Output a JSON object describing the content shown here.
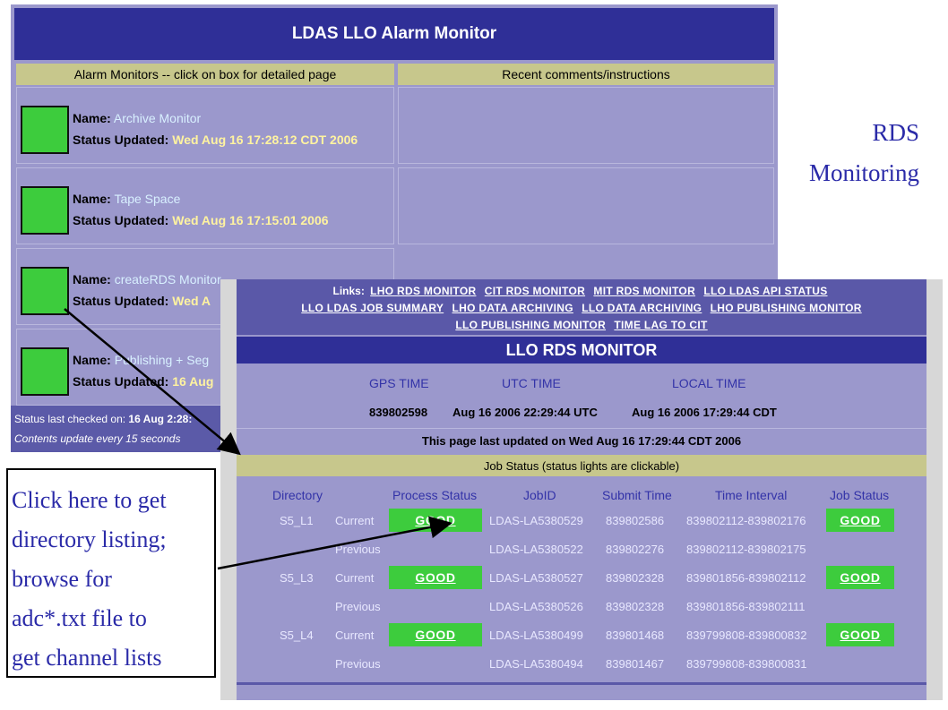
{
  "alarm": {
    "title": "LDAS LLO Alarm Monitor",
    "col_left": "Alarm Monitors -- click on box for detailed page",
    "col_right": "Recent comments/instructions",
    "name_label": "Name:",
    "status_label": "Status Updated:",
    "rows": [
      {
        "name": "Archive Monitor",
        "updated": "Wed Aug 16 17:28:12 CDT 2006"
      },
      {
        "name": "Tape Space",
        "updated": "Wed Aug 16 17:15:01 2006"
      },
      {
        "name": "createRDS Monitor",
        "updated": "Wed A"
      },
      {
        "name": "Publishing + Seg",
        "updated": "16 Aug"
      }
    ],
    "footer_label": "Status last checked on:",
    "footer_value": "16 Aug 2:28:",
    "footer_note": "Contents update every 15 seconds",
    "status_color": "#3dcc3d"
  },
  "caption": {
    "line1": "RDS",
    "line2": "Monitoring"
  },
  "rds": {
    "links_label": "Links:",
    "links": [
      "LHO RDS MONITOR",
      "CIT RDS MONITOR",
      "MIT RDS MONITOR",
      "LLO LDAS API STATUS",
      "LLO LDAS JOB SUMMARY",
      "LHO DATA ARCHIVING",
      "LLO DATA ARCHIVING",
      "LHO PUBLISHING MONITOR",
      "LLO PUBLISHING MONITOR",
      "TIME LAG TO CIT"
    ],
    "title": "LLO RDS MONITOR",
    "time_heads": {
      "gps": "GPS TIME",
      "utc": "UTC TIME",
      "local": "LOCAL TIME"
    },
    "time_values": {
      "gps": "839802598",
      "utc": "Aug 16 2006 22:29:44 UTC",
      "local": "Aug 16 2006 17:29:44 CDT"
    },
    "last_updated": "This page last updated on Wed Aug 16 17:29:44 CDT 2006",
    "job_head": "Job Status (status lights are clickable)",
    "columns": [
      "Directory",
      "Process Status",
      "JobID",
      "Submit Time",
      "Time Interval",
      "Job Status"
    ],
    "rows": [
      {
        "dir": "S5_L1",
        "which": "Current",
        "process": "GOOD",
        "jobid": "LDAS-LA5380529",
        "submit": "839802586",
        "interval": "839802112-839802176",
        "job": "GOOD"
      },
      {
        "dir": "",
        "which": "Previous",
        "process": "",
        "jobid": "LDAS-LA5380522",
        "submit": "839802276",
        "interval": "839802112-839802175",
        "job": ""
      },
      {
        "dir": "S5_L3",
        "which": "Current",
        "process": "GOOD",
        "jobid": "LDAS-LA5380527",
        "submit": "839802328",
        "interval": "839801856-839802112",
        "job": "GOOD"
      },
      {
        "dir": "",
        "which": "Previous",
        "process": "",
        "jobid": "LDAS-LA5380526",
        "submit": "839802328",
        "interval": "839801856-839802111",
        "job": ""
      },
      {
        "dir": "S5_L4",
        "which": "Current",
        "process": "GOOD",
        "jobid": "LDAS-LA5380499",
        "submit": "839801468",
        "interval": "839799808-839800832",
        "job": "GOOD"
      },
      {
        "dir": "",
        "which": "Previous",
        "process": "",
        "jobid": "LDAS-LA5380494",
        "submit": "839801467",
        "interval": "839799808-839800831",
        "job": ""
      }
    ]
  },
  "note": {
    "lines": [
      "Click here to get",
      "directory listing;",
      "browse for",
      "adc*.txt file to",
      "get channel lists"
    ]
  }
}
